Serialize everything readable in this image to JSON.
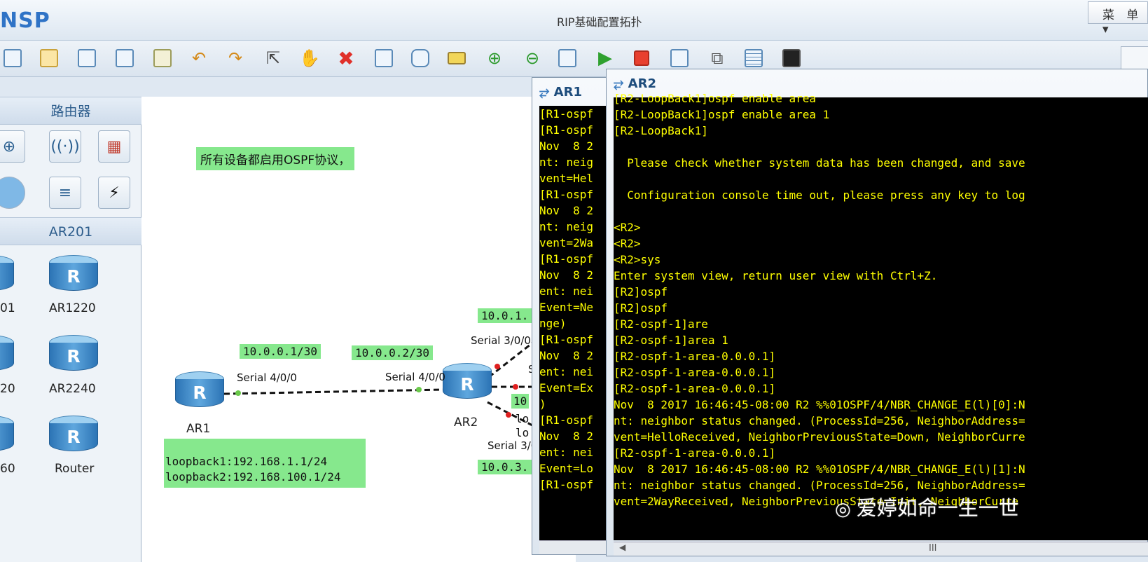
{
  "app": {
    "logo": "NSP",
    "title": "RIP基础配置拓扑",
    "menu_label": "菜 单▾"
  },
  "toolbar": {
    "icons": [
      "new-topo-icon",
      "open-icon",
      "save-icon",
      "save-as-icon",
      "print-icon",
      "undo-icon",
      "redo-icon",
      "select-pointer-icon",
      "hand-icon",
      "delete-icon",
      "delete-link-icon",
      "text-note-icon",
      "rectangle-icon",
      "zoom-in-icon",
      "zoom-out-icon",
      "fit-icon",
      "start-icon",
      "stop-icon",
      "capture-icon",
      "topology-icon",
      "grid-icon",
      "terminal-icon"
    ]
  },
  "leftpanel": {
    "category": "路由器",
    "subcategory": "AR201",
    "routers": [
      {
        "label": "01"
      },
      {
        "label": "AR1220"
      },
      {
        "label": "20"
      },
      {
        "label": "AR2240"
      },
      {
        "label": "60"
      },
      {
        "label": "Router"
      }
    ]
  },
  "canvas": {
    "note_ospf": "所有设备都启用OSPF协议，",
    "ar1_name": "AR1",
    "ar2_name": "AR2",
    "ar1_if": "Serial 4/0/0",
    "ar2_if_left": "Serial 4/0/0",
    "ar2_if_top": "Serial 3/0/0",
    "ar2_if_bottom": "Serial 3/0",
    "ip_ar1": "10.0.0.1/30",
    "ip_ar2": "10.0.0.2/30",
    "ip_top": "10.0.1.",
    "ip_bottom": "10.0.3.",
    "stub_10": "10",
    "stub_lo1": "lo",
    "stub_lo2": "lo",
    "stub_s": "S",
    "loopback1": "loopback1:192.168.1.1/24",
    "loopback2": "loopback2:192.168.100.1/24"
  },
  "ar1_window": {
    "title": "AR1",
    "lines": [
      "[R1-ospf",
      "[R1-ospf",
      "Nov  8 2",
      "nt: neig",
      "vent=Hel",
      "[R1-ospf",
      "Nov  8 2",
      "nt: neig",
      "vent=2Wa",
      "[R1-ospf",
      "Nov  8 2",
      "ent: nei",
      "Event=Ne",
      "nge)",
      "[R1-ospf",
      "Nov  8 2",
      "ent: nei",
      "Event=Ex",
      ")",
      "[R1-ospf",
      "Nov  8 2",
      "ent: nei",
      "Event=Lo",
      "[R1-ospf"
    ]
  },
  "ar2_window": {
    "title": "AR2",
    "lines": [
      "[R2-LoopBack1]ospf enable area",
      "[R2-LoopBack1]ospf enable area 1",
      "[R2-LoopBack1]",
      "",
      "  Please check whether system data has been changed, and save",
      "",
      "  Configuration console time out, please press any key to log",
      "",
      "<R2>",
      "<R2>",
      "<R2>sys",
      "Enter system view, return user view with Ctrl+Z.",
      "[R2]ospf",
      "[R2]ospf",
      "[R2-ospf-1]are",
      "[R2-ospf-1]area 1",
      "[R2-ospf-1-area-0.0.0.1]",
      "[R2-ospf-1-area-0.0.0.1]",
      "[R2-ospf-1-area-0.0.0.1]",
      "Nov  8 2017 16:46:45-08:00 R2 %%01OSPF/4/NBR_CHANGE_E(l)[0]:N",
      "nt: neighbor status changed. (ProcessId=256, NeighborAddress=",
      "vent=HelloReceived, NeighborPreviousState=Down, NeighborCurre",
      "[R2-ospf-1-area-0.0.0.1]",
      "Nov  8 2017 16:46:45-08:00 R2 %%01OSPF/4/NBR_CHANGE_E(l)[1]:N",
      "nt: neighbor status changed. (ProcessId=256, NeighborAddress=",
      "vent=2WayReceived, NeighborPreviousState=Init, NeighborCurre"
    ],
    "scroll_label": "III"
  },
  "watermark": "爱婷如命一生一世"
}
